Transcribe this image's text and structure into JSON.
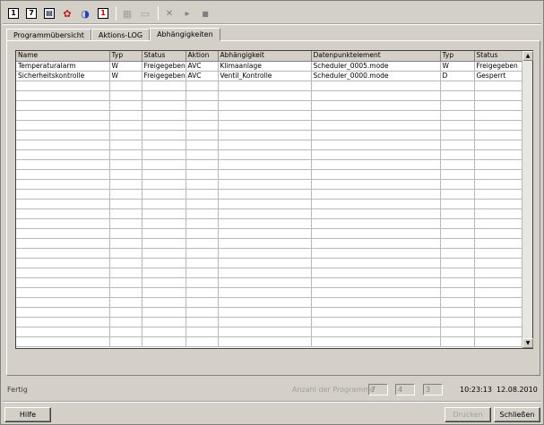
{
  "toolbar": {
    "buttons": [
      {
        "name": "calendar-1-icon",
        "glyph": "1"
      },
      {
        "name": "calendar-7-icon",
        "glyph": "7"
      },
      {
        "name": "calendar-month-icon",
        "glyph": "▤"
      },
      {
        "name": "colors-icon",
        "glyph": "✿"
      },
      {
        "name": "chart-icon",
        "glyph": "◑"
      },
      {
        "name": "calendar-today-icon",
        "glyph": "1"
      },
      {
        "name": "new-icon",
        "glyph": "▦"
      },
      {
        "name": "copy-icon",
        "glyph": "▭"
      },
      {
        "name": "delete-icon",
        "glyph": "✕"
      },
      {
        "name": "play-icon",
        "glyph": "▸"
      },
      {
        "name": "stop-icon",
        "glyph": "■"
      }
    ]
  },
  "tabs": [
    {
      "label": "Programmübersicht"
    },
    {
      "label": "Aktions-LOG"
    },
    {
      "label": "Abhängigkeiten"
    }
  ],
  "table": {
    "columns": [
      "Name",
      "Typ",
      "Status",
      "Aktion",
      "Abhängigkeit",
      "Datenpunktelement",
      "Typ",
      "Status"
    ],
    "rows": [
      [
        "Temperaturalarm",
        "W",
        "Freigegeben",
        "AVC",
        "Klimaanlage",
        "Scheduler_0005.mode",
        "W",
        "Freigegeben"
      ],
      [
        "Sicherheitskontrolle",
        "W",
        "Freigegeben",
        "AVC",
        "Ventil_Kontrolle",
        "Scheduler_0000.mode",
        "D",
        "Gesperrt"
      ]
    ]
  },
  "status": {
    "text": "Fertig",
    "count_label": "Anzahl der Programme",
    "counts": [
      "7",
      "4",
      "3"
    ],
    "time": "10:23:13",
    "date": "12.08.2010"
  },
  "buttons": {
    "help": "Hilfe",
    "print": "Drucken",
    "close": "Schließen"
  }
}
